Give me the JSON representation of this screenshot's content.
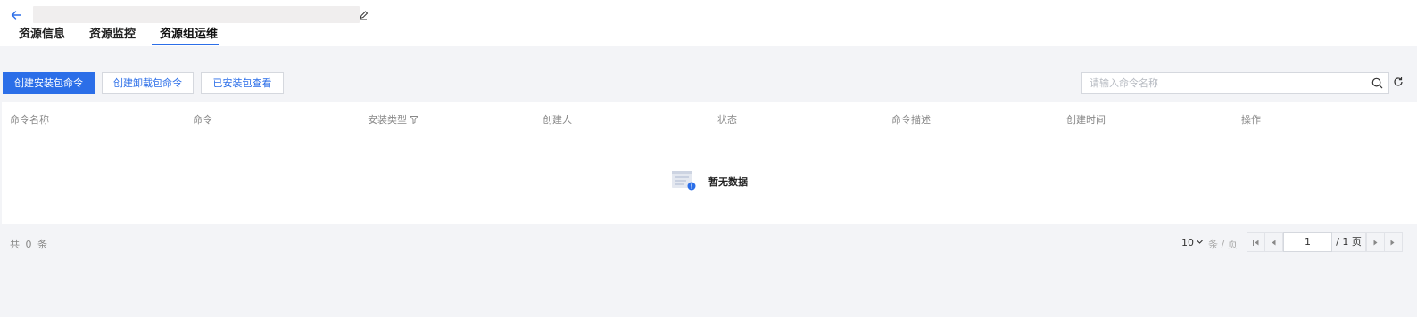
{
  "header": {
    "back_icon": "arrow-left-icon",
    "title": "",
    "title_icon": "edit-icon"
  },
  "tabs": [
    {
      "label": "资源信息",
      "active": false
    },
    {
      "label": "资源监控",
      "active": false
    },
    {
      "label": "资源组运维",
      "active": true
    }
  ],
  "toolbar": {
    "create_install": "创建安装包命令",
    "create_uninstall": "创建卸载包命令",
    "installed_view": "已安装包查看"
  },
  "search": {
    "placeholder": "请输入命令名称",
    "value": "",
    "icon": "search-icon"
  },
  "table": {
    "columns": [
      "命令名称",
      "命令",
      "安装类型",
      "创建人",
      "状态",
      "命令描述",
      "创建时间",
      "操作"
    ],
    "filter_column": "安装类型",
    "rows": [],
    "empty_text": "暂无数据"
  },
  "footer": {
    "total_text": "共 0 条",
    "page_size": "10",
    "page_size_unit": "条 / 页",
    "current_page": "1",
    "total_pages_text": "/ 1 页"
  },
  "colors": {
    "primary": "#2b6ee8",
    "background": "#f3f4f7"
  }
}
